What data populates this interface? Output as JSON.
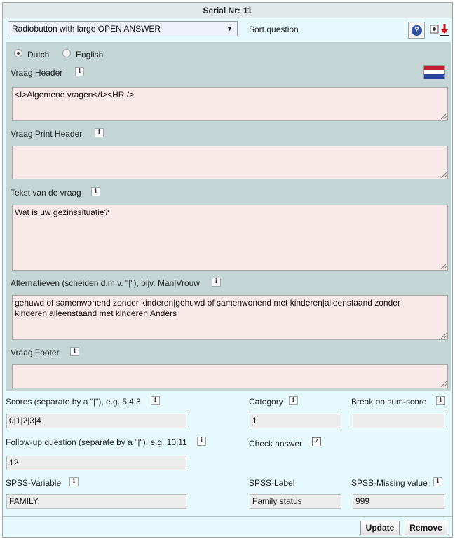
{
  "title": {
    "label": "Serial Nr:",
    "value": "11"
  },
  "toolbar": {
    "question_type": "Radiobutton with large OPEN ANSWER",
    "sort_label": "Sort question",
    "help_icon_text": "?"
  },
  "language": {
    "options": [
      {
        "label": "Dutch",
        "selected": true
      },
      {
        "label": "English",
        "selected": false
      }
    ]
  },
  "fields": {
    "header": {
      "label": "Vraag Header",
      "value": "<I>Algemene vragen</I><HR />"
    },
    "print_header": {
      "label": "Vraag Print Header",
      "value": ""
    },
    "text": {
      "label": "Tekst van de vraag",
      "value": "Wat is uw gezinssituatie?"
    },
    "alternatives": {
      "label": "Alternatieven (scheiden d.m.v. \"|\"), bijv. Man|Vrouw",
      "value": "gehuwd of samenwonend zonder kinderen|gehuwd of samenwonend met kinderen|alleenstaand zonder kinderen|alleenstaand met kinderen|Anders"
    },
    "footer": {
      "label": "Vraag Footer",
      "value": ""
    }
  },
  "settings": {
    "scores": {
      "label": "Scores (separate by a \"|\"), e.g. 5|4|3",
      "value": "0|1|2|3|4"
    },
    "category": {
      "label": "Category",
      "value": "1"
    },
    "break_on_sum": {
      "label": "Break on sum-score",
      "value": ""
    },
    "followup": {
      "label": "Follow-up question (separate by a \"|\"), e.g. 10|11",
      "value": "12"
    },
    "check_answer": {
      "label": "Check answer",
      "checked": true,
      "mark": "✓"
    },
    "spss_variable": {
      "label": "SPSS-Variable",
      "value": "FAMILY"
    },
    "spss_label": {
      "label": "SPSS-Label",
      "value": "Family status"
    },
    "spss_missing": {
      "label": "SPSS-Missing value",
      "value": "999"
    }
  },
  "info_glyph": "i",
  "buttons": {
    "update": "Update",
    "remove": "Remove"
  },
  "colors": {
    "panel": "#c3d5d5",
    "background": "#e6fafd",
    "textarea": "#fae9e9"
  }
}
